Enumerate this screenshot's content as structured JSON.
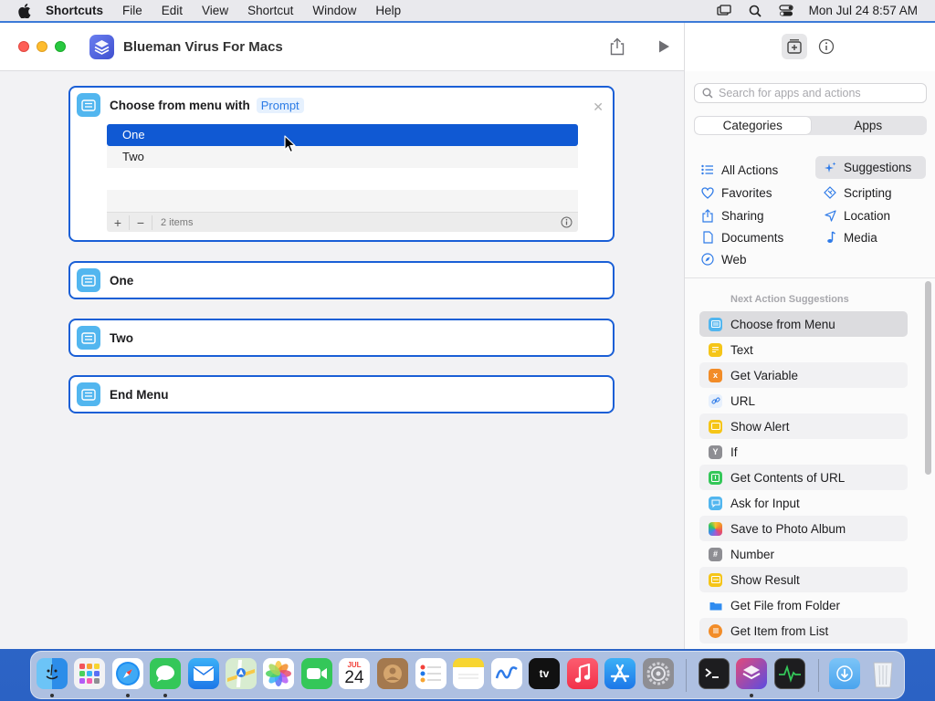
{
  "menubar": {
    "app_name": "Shortcuts",
    "items": [
      "File",
      "Edit",
      "View",
      "Shortcut",
      "Window",
      "Help"
    ],
    "clock": "Mon Jul 24  8:57 AM"
  },
  "window": {
    "title": "Blueman Virus For Macs"
  },
  "editor": {
    "menu_action": {
      "title": "Choose from menu with",
      "prompt_token": "Prompt",
      "items": [
        "One",
        "Two"
      ],
      "count_label": "2 items"
    },
    "cases": [
      "One",
      "Two"
    ],
    "end_menu": "End Menu"
  },
  "sidebar": {
    "search_placeholder": "Search for apps and actions",
    "segments": [
      "Categories",
      "Apps"
    ],
    "categories_left": [
      "All Actions",
      "Favorites",
      "Sharing",
      "Documents",
      "Web"
    ],
    "categories_right": [
      "Suggestions",
      "Scripting",
      "Location",
      "Media"
    ],
    "suggestions_header": "Next Action Suggestions",
    "suggestions": [
      {
        "label": "Choose from Menu",
        "icon": "menu-icon",
        "color": "#52b6ef"
      },
      {
        "label": "Text",
        "icon": "text-icon",
        "color": "#f5c518"
      },
      {
        "label": "Get Variable",
        "icon": "variable-icon",
        "color": "#f28c28"
      },
      {
        "label": "URL",
        "icon": "link-icon",
        "color": "#d8e8fb"
      },
      {
        "label": "Show Alert",
        "icon": "alert-icon",
        "color": "#f5c518"
      },
      {
        "label": "If",
        "icon": "if-icon",
        "color": "#8e8e93"
      },
      {
        "label": "Get Contents of URL",
        "icon": "download-icon",
        "color": "#34c759"
      },
      {
        "label": "Ask for Input",
        "icon": "ask-icon",
        "color": "#52b6ef"
      },
      {
        "label": "Save to Photo Album",
        "icon": "photos-icon",
        "color": "#e96f6f"
      },
      {
        "label": "Number",
        "icon": "number-icon",
        "color": "#8e8e93"
      },
      {
        "label": "Show Result",
        "icon": "result-icon",
        "color": "#f5c518"
      },
      {
        "label": "Get File from Folder",
        "icon": "folder-icon",
        "color": "#2f8cf0"
      },
      {
        "label": "Get Item from List",
        "icon": "list-icon",
        "color": "#f28c28"
      }
    ]
  },
  "dock": {
    "calendar_month": "JUL",
    "calendar_day": "24",
    "tv_label": "tv"
  }
}
